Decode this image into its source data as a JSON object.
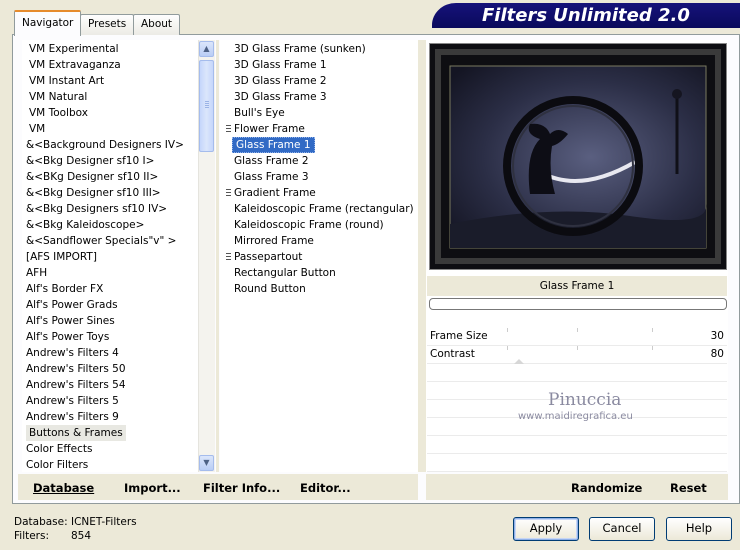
{
  "tabs": [
    {
      "label": "Navigator"
    },
    {
      "label": "Presets"
    },
    {
      "label": "About"
    }
  ],
  "banner": {
    "title": "Filters Unlimited 2.0"
  },
  "categories": {
    "items": [
      "VM Experimental",
      "VM Extravaganza",
      "VM Instant Art",
      "VM Natural",
      "VM Toolbox",
      "VM",
      "&<Background Designers IV>",
      "&<Bkg Designer sf10 I>",
      "&<BKg Designer sf10 II>",
      "&<Bkg Designer sf10 III>",
      "&<Bkg Designers sf10 IV>",
      "&<Bkg Kaleidoscope>",
      "&<Sandflower Specials\"v\" >",
      "[AFS IMPORT]",
      "AFH",
      "Alf's Border FX",
      "Alf's Power Grads",
      "Alf's Power Sines",
      "Alf's Power Toys",
      "Andrew's Filters 4",
      "Andrew's Filters 50",
      "Andrew's Filters 54",
      "Andrew's Filters 5",
      "Andrew's Filters 9",
      "Buttons & Frames",
      "Color Effects",
      "Color Filters"
    ],
    "selected": "Buttons & Frames"
  },
  "filters": {
    "items": [
      {
        "label": "3D Glass Frame (sunken)",
        "grip": false
      },
      {
        "label": "3D Glass Frame 1",
        "grip": false
      },
      {
        "label": "3D Glass Frame 2",
        "grip": false
      },
      {
        "label": "3D Glass Frame 3",
        "grip": false
      },
      {
        "label": "Bull's Eye",
        "grip": false
      },
      {
        "label": "Flower Frame",
        "grip": true
      },
      {
        "label": "Glass Frame 1",
        "grip": false
      },
      {
        "label": "Glass Frame 2",
        "grip": false
      },
      {
        "label": "Glass Frame 3",
        "grip": false
      },
      {
        "label": "Gradient Frame",
        "grip": true
      },
      {
        "label": "Kaleidoscopic Frame (rectangular)",
        "grip": false
      },
      {
        "label": "Kaleidoscopic Frame (round)",
        "grip": false
      },
      {
        "label": "Mirrored Frame",
        "grip": false
      },
      {
        "label": "Passepartout",
        "grip": true
      },
      {
        "label": "Rectangular Button",
        "grip": false
      },
      {
        "label": "Round Button",
        "grip": false
      }
    ],
    "selected": "Glass Frame 1"
  },
  "preview": {
    "filter_name": "Glass Frame 1"
  },
  "params": [
    {
      "label": "Frame Size",
      "value": "30"
    },
    {
      "label": "Contrast",
      "value": "80"
    }
  ],
  "watermark": {
    "name": "Pinuccia",
    "url": "www.maidiregrafica.eu"
  },
  "bottom_links": {
    "database": "Database",
    "import": "Import...",
    "filter_info": "Filter Info...",
    "editor": "Editor...",
    "randomize": "Randomize",
    "reset": "Reset"
  },
  "status": {
    "database_label": "Database:",
    "database_value": "ICNET-Filters",
    "filters_label": "Filters:",
    "filters_value": "854"
  },
  "buttons": {
    "apply": "Apply",
    "cancel": "Cancel",
    "help": "Help"
  },
  "colors": {
    "banner": "#0a0a5c",
    "selection": "#316ac5",
    "tab_highlight": "#e68b2c"
  }
}
